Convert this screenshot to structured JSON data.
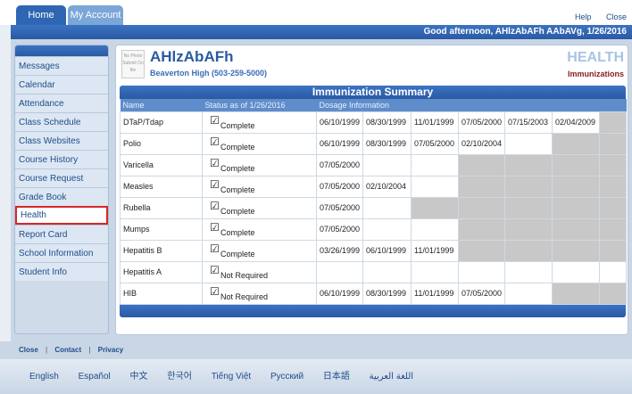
{
  "tabs": {
    "home": "Home",
    "account": "My Account"
  },
  "toplinks": {
    "help": "Help",
    "close": "Close"
  },
  "greeting": "Good afternoon, AHlzAbAFh AAbAVg, 1/26/2016",
  "sidebar": {
    "items": [
      {
        "label": "Messages"
      },
      {
        "label": "Calendar"
      },
      {
        "label": "Attendance"
      },
      {
        "label": "Class Schedule"
      },
      {
        "label": "Class Websites"
      },
      {
        "label": "Course History"
      },
      {
        "label": "Course Request"
      },
      {
        "label": "Grade Book"
      },
      {
        "label": "Health"
      },
      {
        "label": "Report Card"
      },
      {
        "label": "School Information"
      },
      {
        "label": "Student Info"
      }
    ]
  },
  "student": {
    "photo_text": "No Photo Submit On file",
    "name": "AHlzAbAFh",
    "school": "Beaverton High (503-259-5000)"
  },
  "section": {
    "title": "HEALTH",
    "subtitle": "Immunizations"
  },
  "table": {
    "title": "Immunization Summary",
    "headers": {
      "name": "Name",
      "status": "Status as of 1/26/2016",
      "dosage": "Dosage Information"
    },
    "rows": [
      {
        "name": "DTaP/Tdap",
        "status": "Complete",
        "dates": [
          "06/10/1999",
          "08/30/1999",
          "11/01/1999",
          "07/05/2000",
          "07/15/2003",
          "02/04/2009"
        ],
        "gray_from": 6
      },
      {
        "name": "Polio",
        "status": "Complete",
        "dates": [
          "06/10/1999",
          "08/30/1999",
          "07/05/2000",
          "02/10/2004"
        ],
        "gray_from": 5
      },
      {
        "name": "Varicella",
        "status": "Complete",
        "dates": [
          "07/05/2000"
        ],
        "gray_from": 3
      },
      {
        "name": "Measles",
        "status": "Complete",
        "dates": [
          "07/05/2000",
          "02/10/2004"
        ],
        "gray_from": 3
      },
      {
        "name": "Rubella",
        "status": "Complete",
        "dates": [
          "07/05/2000"
        ],
        "gray_from": 2
      },
      {
        "name": "Mumps",
        "status": "Complete",
        "dates": [
          "07/05/2000"
        ],
        "gray_from": 3
      },
      {
        "name": "Hepatitis B",
        "status": "Complete",
        "dates": [
          "03/26/1999",
          "06/10/1999",
          "11/01/1999"
        ],
        "gray_from": 3
      },
      {
        "name": "Hepatitis A",
        "status": "Not Required",
        "dates": [],
        "gray_from": 7
      },
      {
        "name": "HIB",
        "status": "Not Required",
        "dates": [
          "06/10/1999",
          "08/30/1999",
          "11/01/1999",
          "07/05/2000"
        ],
        "gray_from": 5
      }
    ]
  },
  "footer": {
    "close": "Close",
    "contact": "Contact",
    "privacy": "Privacy",
    "sep": "|"
  },
  "languages": [
    "English",
    "Español",
    "中文",
    "한국어",
    "Tiếng Việt",
    "Русский",
    "日本語",
    "اللغة العربية"
  ]
}
